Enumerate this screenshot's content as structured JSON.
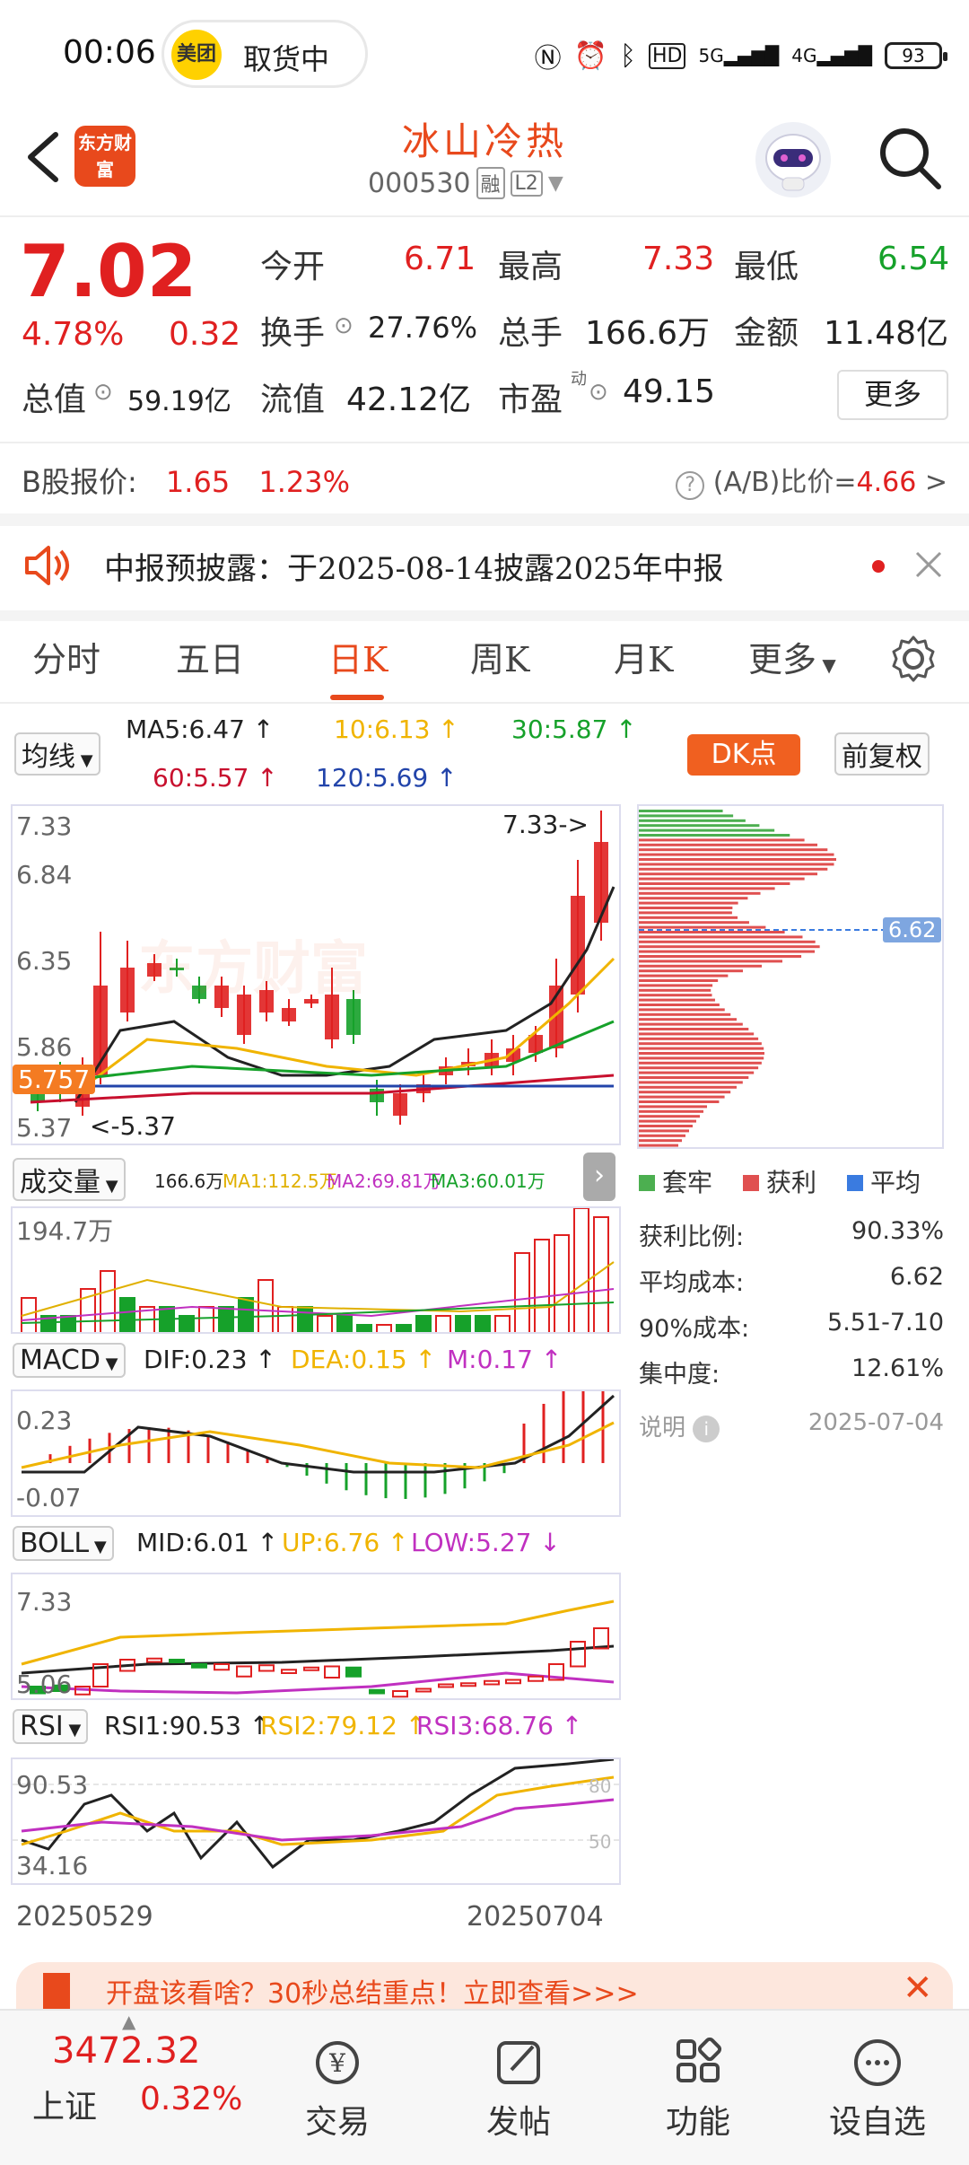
{
  "status": {
    "time": "00:06",
    "pill_brand": "美团",
    "pill_text": "取货中",
    "battery": "93",
    "net1": "5G",
    "net2": "4G"
  },
  "header": {
    "app_logo": "东方财富",
    "title": "冰山冷热",
    "code": "000530",
    "tag1": "融",
    "tag2": "L2"
  },
  "quote": {
    "price": "7.02",
    "pct": "4.78%",
    "change": "0.32",
    "open_label": "今开",
    "open": "6.71",
    "high_label": "最高",
    "high": "7.33",
    "low_label": "最低",
    "low": "6.54",
    "turnover_label": "换手",
    "turnover": "27.76%",
    "volume_label": "总手",
    "volume": "166.6万",
    "amount_label": "金额",
    "amount": "11.48亿",
    "mktcap_label": "总值",
    "mktcap": "59.19亿",
    "float_label": "流值",
    "float": "42.12亿",
    "pe_label": "市盈",
    "pe_sup": "动",
    "pe": "49.15",
    "more": "更多"
  },
  "bshare": {
    "label": "B股报价:",
    "price": "1.65",
    "pct": "1.23%",
    "ratio_label": "(A/B)比价=",
    "ratio": "4.66"
  },
  "notice": {
    "text": "中报预披露：于2025-08-14披露2025年中报"
  },
  "tabs": [
    "分时",
    "五日",
    "日K",
    "周K",
    "月K",
    "更多"
  ],
  "active_tab": 2,
  "ma": {
    "sel": "均线",
    "ma5": "MA5:6.47",
    "ma10": "10:6.13",
    "ma30": "30:5.87",
    "ma60": "60:5.57",
    "ma120": "120:5.69",
    "dk": "DK点",
    "adj": "前复权"
  },
  "kchart": {
    "ytop": "7.33",
    "y2": "6.84",
    "y3": "6.35",
    "y4": "5.86",
    "ybot": "5.37",
    "cur": "5.757",
    "hi_note": "7.33->",
    "lo_note": "<-5.37",
    "watermark": "东方财富"
  },
  "chip": {
    "price_tag": "6.62",
    "legend": [
      "套牢",
      "获利",
      "平均"
    ],
    "rows": [
      {
        "label": "获利比例:",
        "value": "90.33%"
      },
      {
        "label": "平均成本:",
        "value": "6.62"
      },
      {
        "label": "90%成本:",
        "value": "5.51-7.10"
      },
      {
        "label": "集中度:",
        "value": "12.61%"
      }
    ],
    "explain": "说明",
    "date": "2025-07-04"
  },
  "vol": {
    "sel": "成交量",
    "v": "166.6万",
    "ma1": "MA1:112.5万",
    "ma2": "MA2:69.81万",
    "ma3": "MA3:60.01万",
    "ytop": "194.7万"
  },
  "macd": {
    "sel": "MACD",
    "dif": "DIF:0.23",
    "dea": "DEA:0.15",
    "m": "M:0.17",
    "ytop": "0.23",
    "ybot": "-0.07"
  },
  "boll": {
    "sel": "BOLL",
    "mid": "MID:6.01",
    "up": "UP:6.76",
    "low": "LOW:5.27",
    "ytop": "7.33",
    "ybot": "5.06"
  },
  "rsi": {
    "sel": "RSI",
    "r1": "RSI1:90.53",
    "r2": "RSI2:79.12",
    "r3": "RSI3:68.76",
    "ytop": "90.53",
    "ybot": "34.16",
    "l80": "80",
    "l50": "50"
  },
  "dates": {
    "start": "20250529",
    "end": "20250704"
  },
  "banner": {
    "text": "开盘该看啥？30秒总结重点！立即查看>>>"
  },
  "nav": {
    "index_value": "3472.32",
    "index_name": "上证",
    "index_pct": "0.32%",
    "items": [
      "交易",
      "发帖",
      "功能",
      "设自选"
    ]
  }
}
